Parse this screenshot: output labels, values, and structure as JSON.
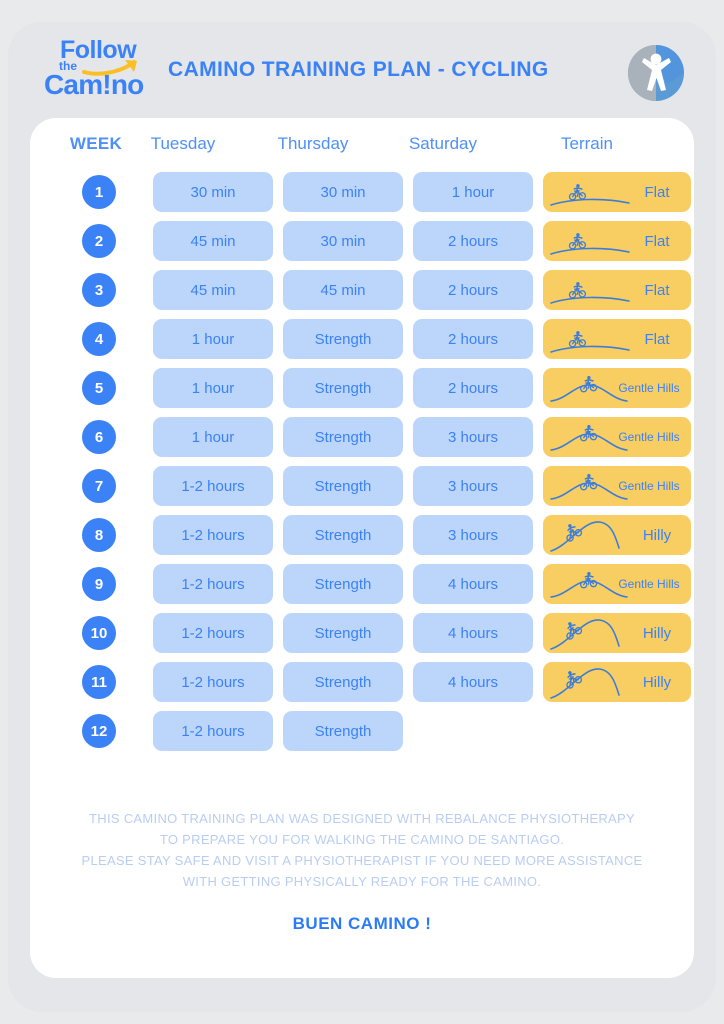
{
  "brand": {
    "logo_follow": "Follow",
    "logo_the": "the",
    "logo_camino": "Cam!no",
    "logo_arrow_icon": "curved-arrow-icon",
    "mark_icon": "person-in-circle-icon",
    "accent_blue": "#3b82f6",
    "pill_blue": "#bcd6fb",
    "terrain_yellow": "#f8ce63",
    "page_background": "#e8eaec"
  },
  "header": {
    "title": "CAMINO TRAINING PLAN - CYCLING"
  },
  "table": {
    "columns": [
      "WEEK",
      "Tuesday",
      "Thursday",
      "Saturday",
      "Terrain"
    ],
    "rows": [
      {
        "week": "1",
        "tuesday": "30 min",
        "thursday": "30 min",
        "saturday": "1 hour",
        "terrain": "Flat",
        "terrain_icon": "cyclist-flat-icon"
      },
      {
        "week": "2",
        "tuesday": "45 min",
        "thursday": "30 min",
        "saturday": "2 hours",
        "terrain": "Flat",
        "terrain_icon": "cyclist-flat-icon"
      },
      {
        "week": "3",
        "tuesday": "45 min",
        "thursday": "45 min",
        "saturday": "2 hours",
        "terrain": "Flat",
        "terrain_icon": "cyclist-flat-icon"
      },
      {
        "week": "4",
        "tuesday": "1 hour",
        "thursday": "Strength",
        "saturday": "2 hours",
        "terrain": "Flat",
        "terrain_icon": "cyclist-flat-icon"
      },
      {
        "week": "5",
        "tuesday": "1 hour",
        "thursday": "Strength",
        "saturday": "2 hours",
        "terrain": "Gentle Hills",
        "terrain_icon": "cyclist-gentle-hills-icon"
      },
      {
        "week": "6",
        "tuesday": "1 hour",
        "thursday": "Strength",
        "saturday": "3 hours",
        "terrain": "Gentle Hills",
        "terrain_icon": "cyclist-gentle-hills-icon"
      },
      {
        "week": "7",
        "tuesday": "1-2 hours",
        "thursday": "Strength",
        "saturday": "3 hours",
        "terrain": "Gentle Hills",
        "terrain_icon": "cyclist-gentle-hills-icon"
      },
      {
        "week": "8",
        "tuesday": "1-2 hours",
        "thursday": "Strength",
        "saturday": "3 hours",
        "terrain": "Hilly",
        "terrain_icon": "cyclist-hilly-icon"
      },
      {
        "week": "9",
        "tuesday": "1-2 hours",
        "thursday": "Strength",
        "saturday": "4 hours",
        "terrain": "Gentle Hills",
        "terrain_icon": "cyclist-gentle-hills-icon"
      },
      {
        "week": "10",
        "tuesday": "1-2 hours",
        "thursday": "Strength",
        "saturday": "4 hours",
        "terrain": "Hilly",
        "terrain_icon": "cyclist-hilly-icon"
      },
      {
        "week": "11",
        "tuesday": "1-2 hours",
        "thursday": "Strength",
        "saturday": "4 hours",
        "terrain": "Hilly",
        "terrain_icon": "cyclist-hilly-icon"
      },
      {
        "week": "12",
        "tuesday": "1-2 hours",
        "thursday": "Strength",
        "saturday": "",
        "terrain": "",
        "terrain_icon": ""
      }
    ]
  },
  "footer": {
    "lines": [
      "THIS CAMINO TRAINING PLAN WAS DESIGNED WITH REBALANCE PHYSIOTHERAPY",
      "TO PREPARE YOU FOR WALKING THE CAMINO DE SANTIAGO.",
      "PLEASE STAY SAFE AND VISIT A PHYSIOTHERAPIST IF YOU NEED MORE ASSISTANCE",
      "WITH GETTING PHYSICALLY READY FOR THE CAMINO."
    ],
    "cta": "BUEN CAMINO !"
  }
}
